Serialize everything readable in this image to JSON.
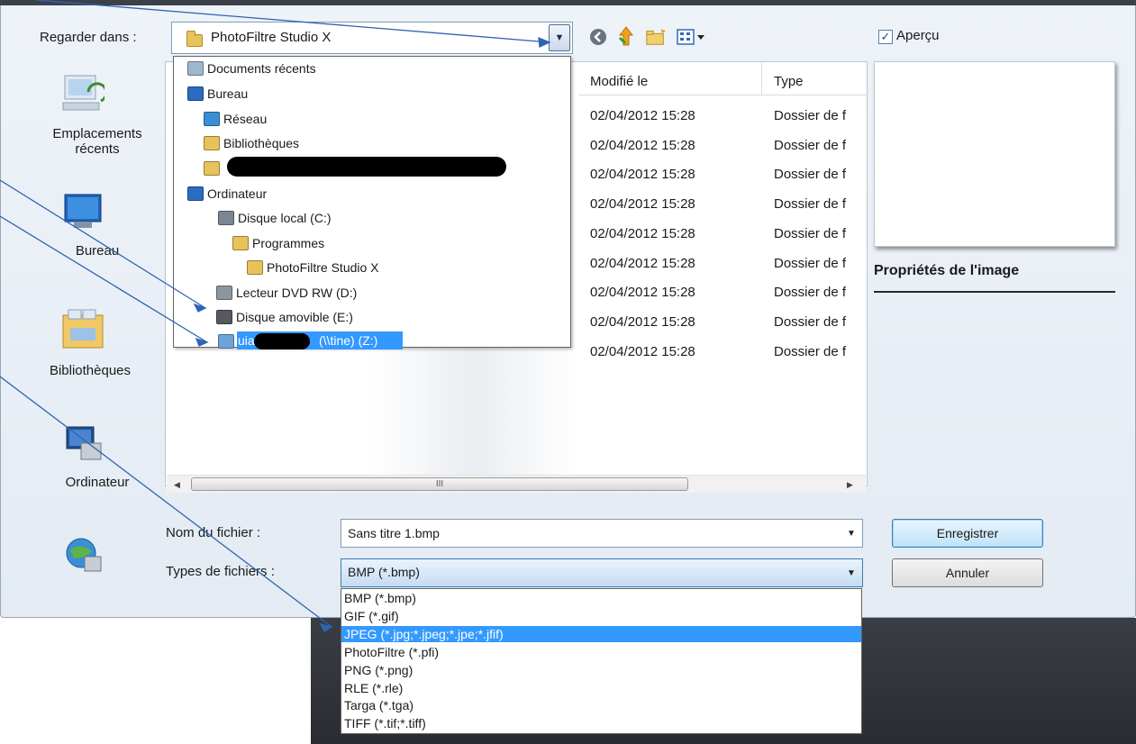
{
  "look_in": {
    "label": "Regarder dans :",
    "value": "PhotoFiltre Studio X"
  },
  "toolbar": {
    "icons": [
      "back-icon",
      "up-folder-icon",
      "new-folder-icon",
      "views-menu-icon"
    ]
  },
  "preview": {
    "label": "Aperçu",
    "checked": true,
    "props_title": "Propriétés de l'image"
  },
  "places": [
    {
      "label1": "Emplacements",
      "label2": "récents",
      "icon": "recent-places-icon"
    },
    {
      "label1": "Bureau",
      "icon": "desktop-icon"
    },
    {
      "label1": "Bibliothèques",
      "icon": "libraries-icon"
    },
    {
      "label1": "Ordinateur",
      "icon": "computer-icon"
    },
    {
      "label1": "",
      "icon": "network-icon"
    }
  ],
  "tree": [
    {
      "label": "Documents récents",
      "icon": "recent-documents-icon"
    },
    {
      "label": "Bureau",
      "icon": "desktop-icon"
    },
    {
      "label": "Réseau",
      "icon": "network-icon"
    },
    {
      "label": "Bibliothèques",
      "icon": "libraries-icon"
    },
    {
      "label": "",
      "icon": "user-folder-icon"
    },
    {
      "label": "Ordinateur",
      "icon": "computer-icon"
    },
    {
      "label": "Disque local (C:)",
      "icon": "local-disk-icon"
    },
    {
      "label": "Programmes",
      "icon": "folder-icon"
    },
    {
      "label": "PhotoFiltre Studio X",
      "icon": "folder-icon"
    },
    {
      "label": "Lecteur DVD RW (D:)",
      "icon": "dvd-drive-icon"
    },
    {
      "label": "Disque amovible (E:)",
      "icon": "removable-disk-icon"
    },
    {
      "label_pre": "uia",
      "label_post": "(\\\\tine) (Z:)",
      "icon": "network-drive-icon"
    }
  ],
  "file_list": {
    "columns": [
      "Modifié le",
      "Type"
    ],
    "rows": [
      {
        "modified": "02/04/2012 15:28",
        "type": "Dossier de f"
      },
      {
        "modified": "02/04/2012 15:28",
        "type": "Dossier de f"
      },
      {
        "modified": "02/04/2012 15:28",
        "type": "Dossier de f"
      },
      {
        "modified": "02/04/2012 15:28",
        "type": "Dossier de f"
      },
      {
        "modified": "02/04/2012 15:28",
        "type": "Dossier de f"
      },
      {
        "modified": "02/04/2012 15:28",
        "type": "Dossier de f"
      },
      {
        "modified": "02/04/2012 15:28",
        "type": "Dossier de f"
      },
      {
        "modified": "02/04/2012 15:28",
        "type": "Dossier de f"
      },
      {
        "modified": "02/04/2012 15:28",
        "type": "Dossier de f"
      }
    ]
  },
  "scrollbar": {
    "thumb_grip": "III"
  },
  "file_name": {
    "label": "Nom du fichier :",
    "value": "Sans titre 1.bmp"
  },
  "file_type": {
    "label": "Types de fichiers :",
    "value": "BMP (*.bmp)",
    "options": [
      "BMP (*.bmp)",
      "GIF (*.gif)",
      "JPEG (*.jpg;*.jpeg;*.jpe;*.jfif)",
      "PhotoFiltre (*.pfi)",
      "PNG (*.png)",
      "RLE (*.rle)",
      "Targa (*.tga)",
      "TIFF (*.tif;*.tiff)"
    ],
    "highlighted": "JPEG (*.jpg;*.jpeg;*.jpe;*.jfif)"
  },
  "buttons": {
    "save": "Enregistrer",
    "cancel": "Annuler"
  },
  "colors": {
    "selection": "#3399ff",
    "callout": "#2f64b3"
  }
}
